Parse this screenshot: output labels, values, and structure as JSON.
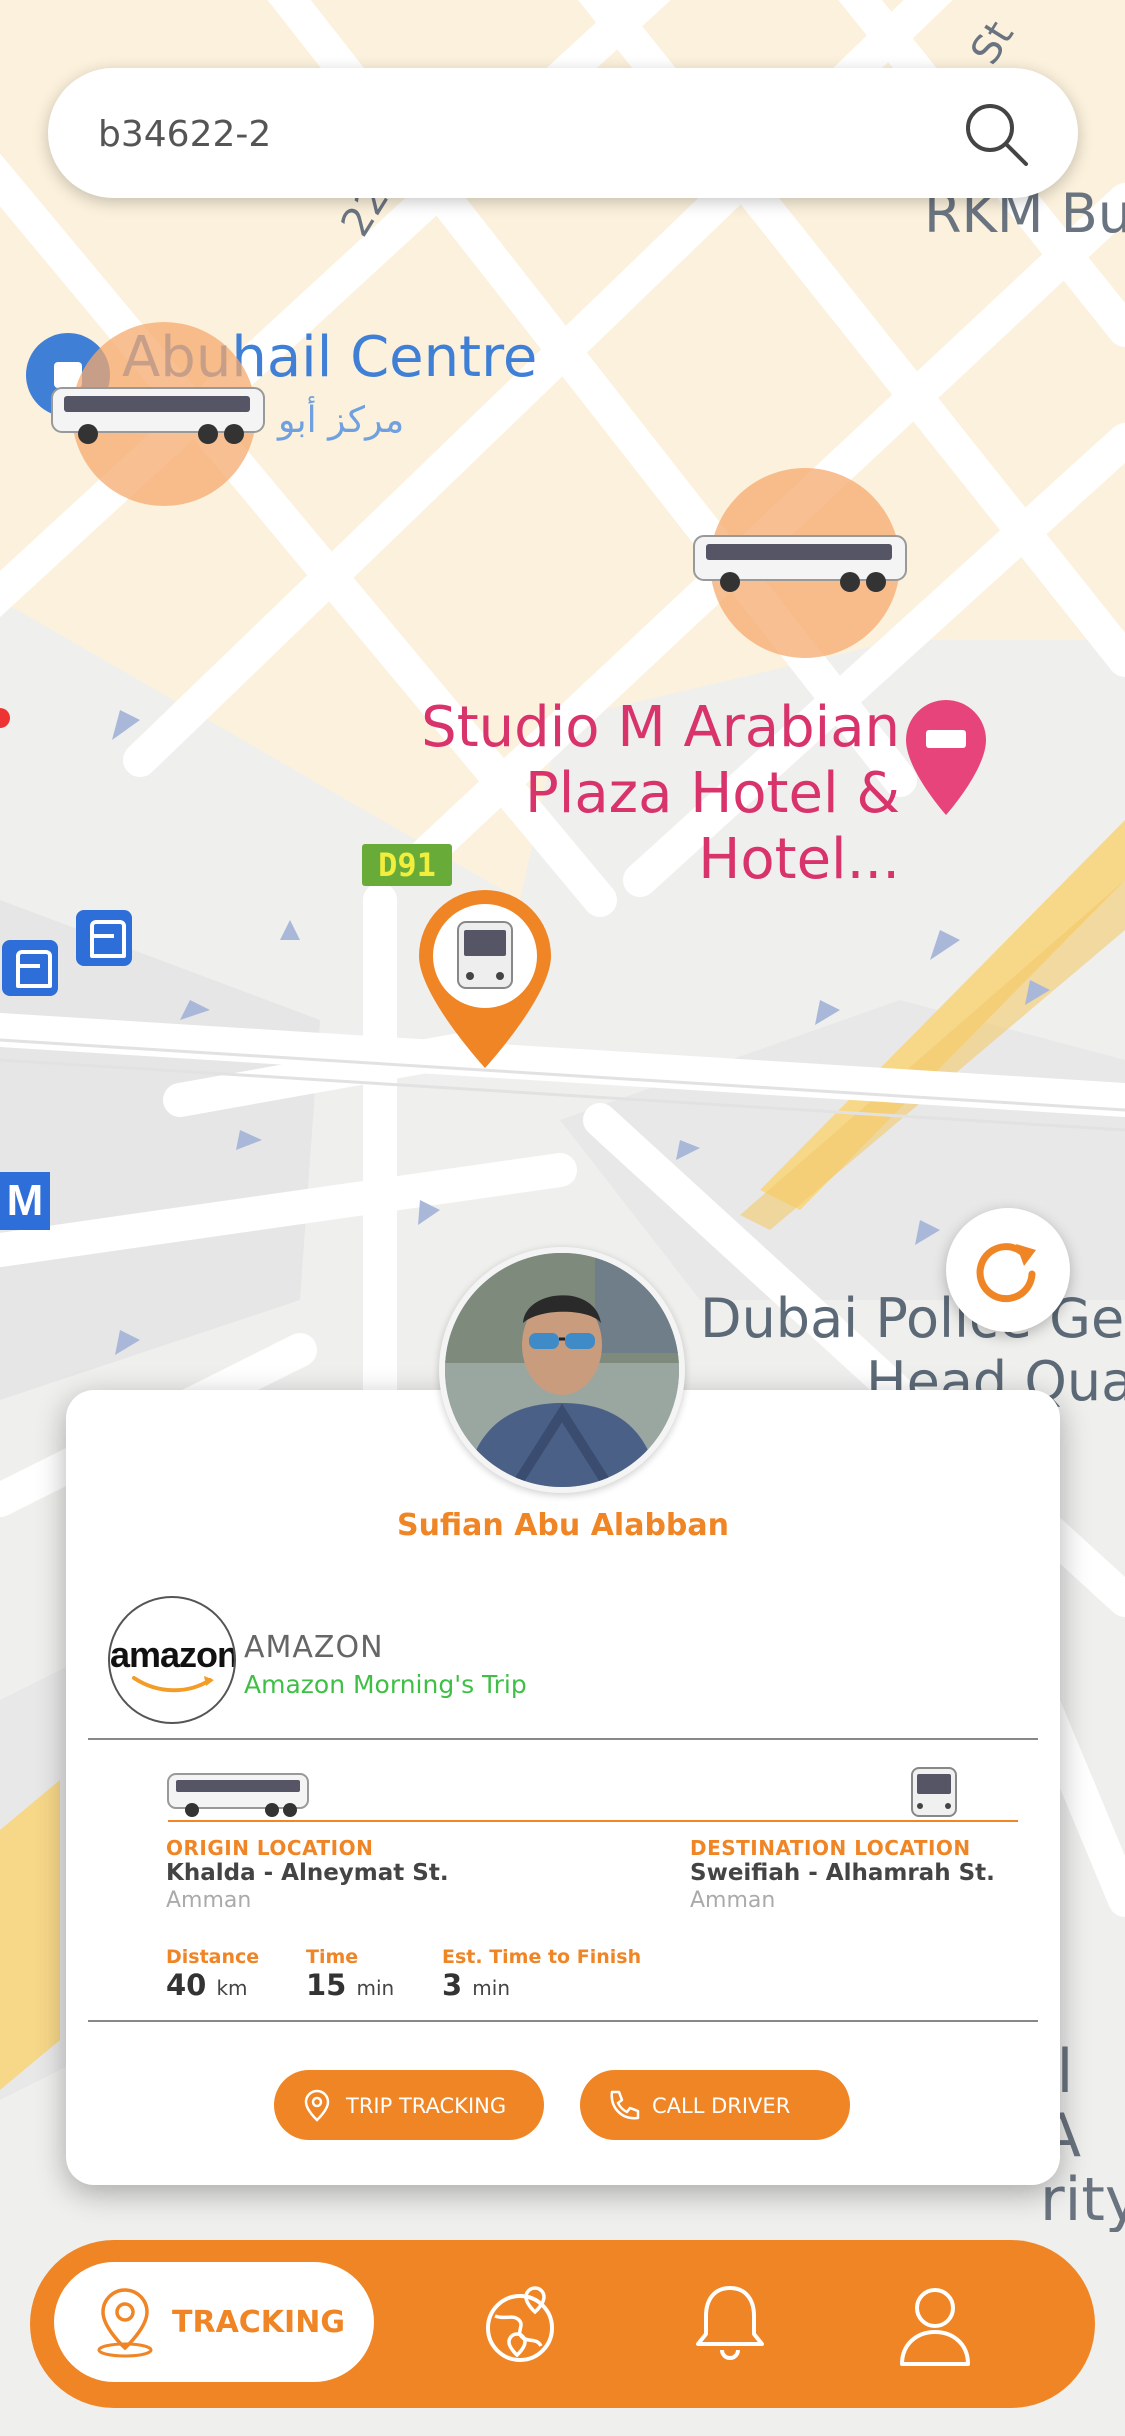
{
  "search": {
    "value": "b34622-2",
    "placeholder": "Search"
  },
  "map": {
    "labels": {
      "abuhail": "Abuhail Centre",
      "abuhail_ar": "مركز أبو",
      "studio": "Studio M Arabian Plaza Hotel & Hotel...",
      "rkm": "RKM Bu",
      "street": "22 A St",
      "street2": "St",
      "police": "Dubai Police Ge",
      "police2": "Head Qua",
      "right_partial": "il A rity"
    },
    "route_tag": "D91",
    "metro": "M"
  },
  "driver": {
    "name": "Sufian Abu Alabban"
  },
  "company": {
    "logo_text": "amazon",
    "name": "AMAZON",
    "trip": "Amazon Morning's Trip"
  },
  "origin": {
    "label": "ORIGIN LOCATION",
    "street": "Khalda - Alneymat St.",
    "city": "Amman"
  },
  "destination": {
    "label": "DESTINATION LOCATION",
    "street": "Sweifiah - Alhamrah St.",
    "city": "Amman"
  },
  "stats": {
    "distance": {
      "label": "Distance",
      "value": "40",
      "unit": "km"
    },
    "time": {
      "label": "Time",
      "value": "15",
      "unit": "min"
    },
    "finish": {
      "label": "Est. Time to Finish",
      "value": "3",
      "unit": "min"
    }
  },
  "actions": {
    "trip_tracking": "TRIP TRACKING",
    "call_driver": "CALL DRIVER"
  },
  "nav": {
    "active_label": "TRACKING"
  },
  "colors": {
    "accent": "#f08525",
    "trip_green": "#3fbf45",
    "map_bg": "#f2f2f0",
    "road": "#ffffff",
    "block": "#fdf0d8"
  },
  "icons": [
    "search-icon",
    "bus-icon",
    "location-pin-icon",
    "refresh-icon",
    "globe-pins-icon",
    "bell-icon",
    "user-icon",
    "phone-icon",
    "hotel-icon"
  ]
}
